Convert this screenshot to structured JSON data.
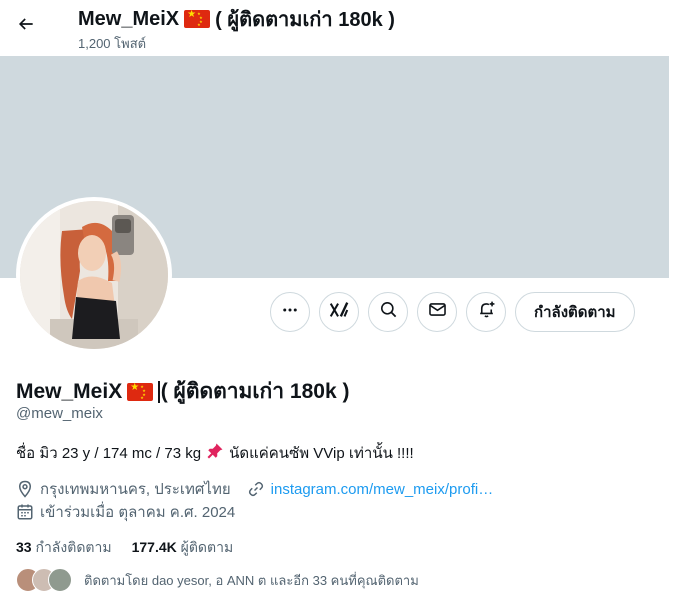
{
  "header": {
    "name_prefix": "Mew_MeiX",
    "name_suffix": "( ผู้ติดตามเก่า 180k )",
    "posts_count": "1,200 โพสต์"
  },
  "profile": {
    "display_name_prefix": "Mew_MeiX",
    "display_name_suffix": "( ผู้ติดตามเก่า 180k )",
    "handle": "@mew_meix",
    "bio_part1": "ชื่อ มิว 23 y / 174 mc / 73 kg",
    "bio_part2": "นัดแค่คนซัพ VVip เท่านั้น !!!!",
    "location": "กรุงเทพมหานคร, ประเทศไทย",
    "website": "instagram.com/mew_meix/profi…",
    "joined": "เข้าร่วมเมื่อ ตุลาคม ค.ศ. 2024"
  },
  "actions": {
    "following_label": "กำลังติดตาม"
  },
  "stats": {
    "following_count": "33",
    "following_label": "กำลังติดตาม",
    "followers_count": "177.4K",
    "followers_label": "ผู้ติดตาม"
  },
  "followed_by": {
    "text": "ติดตามโดย dao yesor, อ ANN ต และอีก 33 คนที่คุณติดตาม"
  },
  "colors": {
    "banner": "#cfd9de",
    "link": "#1d9bf0",
    "secondary_text": "#536471",
    "flag_red": "#de2910",
    "flag_yellow": "#ffde00"
  },
  "icons": {
    "back": "arrow-left-icon",
    "more": "more-dots-icon",
    "grok": "grok-icon",
    "search": "search-icon",
    "message": "envelope-icon",
    "notify": "bell-plus-icon",
    "location": "location-pin-icon",
    "link": "link-icon",
    "calendar": "calendar-icon",
    "pin": "pushpin-icon",
    "flag": "china-flag-icon"
  }
}
